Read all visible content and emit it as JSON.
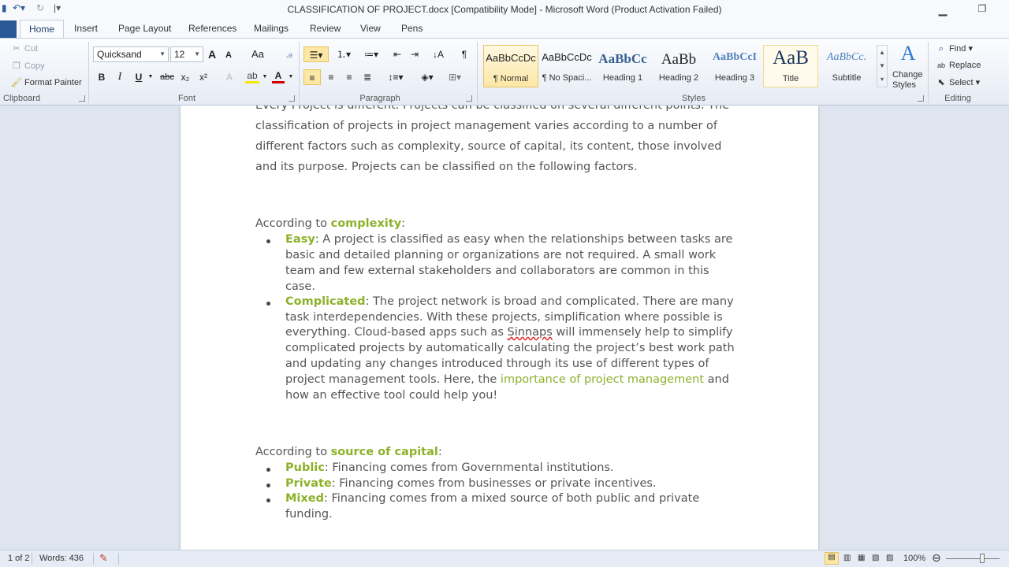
{
  "window": {
    "title": "CLASSIFICATION OF PROJECT.docx [Compatibility Mode]  -  Microsoft Word (Product Activation Failed)"
  },
  "quick_access": {
    "save_icon": "save-icon",
    "undo_icon": "undo-icon",
    "redo_icon": "redo-icon"
  },
  "tabs": [
    {
      "label": "Home",
      "active": true
    },
    {
      "label": "Insert"
    },
    {
      "label": "Page Layout"
    },
    {
      "label": "References"
    },
    {
      "label": "Mailings"
    },
    {
      "label": "Review"
    },
    {
      "label": "View"
    },
    {
      "label": "Pens"
    }
  ],
  "clipboard": {
    "label": "Clipboard",
    "cut": "Cut",
    "copy": "Copy",
    "format_painter": "Format Painter"
  },
  "font": {
    "label": "Font",
    "name": "Quicksand",
    "size": "12",
    "grow": "A",
    "shrink": "A",
    "change_case": "Aa",
    "bold": "B",
    "italic": "I",
    "underline": "U",
    "strikethrough": "abc",
    "subscript": "x₂",
    "superscript": "x²",
    "font_color": "A"
  },
  "paragraph": {
    "label": "Paragraph",
    "show_marks": "¶"
  },
  "styles": {
    "label": "Styles",
    "items": [
      {
        "sample": "AaBbCcDc",
        "name": "¶ Normal"
      },
      {
        "sample": "AaBbCcDc",
        "name": "¶ No Spaci..."
      },
      {
        "sample": "AaBbCc",
        "name": "Heading 1"
      },
      {
        "sample": "AaBb",
        "name": "Heading 2"
      },
      {
        "sample": "AaBbCcI",
        "name": "Heading 3"
      },
      {
        "sample": "AaB",
        "name": "Title"
      },
      {
        "sample": "AaBbCc.",
        "name": "Subtitle"
      }
    ],
    "change_styles_line1": "Change",
    "change_styles_line2": "Styles"
  },
  "editing": {
    "label": "Editing",
    "find": "Find",
    "replace": "Replace",
    "select": "Select"
  },
  "document": {
    "intro_top": "Every Project is different. Projects can be classified on several different points. The",
    "intro": [
      "classification of projects in project management varies according to a number of",
      "different factors such as complexity, source of capital, its content, those involved",
      "and its purpose. Projects can be classified on the following factors."
    ],
    "complexity_heading_prefix": "According to ",
    "complexity_heading_term": "complexity",
    "complexity_heading_suffix": ":",
    "easy_term": "Easy",
    "easy_lines": [
      ": A project is classified as easy when the relationships between tasks are",
      "basic and detailed planning or organizations are not required. A small work",
      "team and few external stakeholders and collaborators are common in this",
      "case."
    ],
    "complicated_term": "Complicated",
    "complicated_line1": ": The project network is broad and complicated. There are many",
    "complicated_line2": "task interdependencies. With these projects, simplification where possible is",
    "complicated_line3_a": "everything. Cloud-based apps such as ",
    "complicated_line3_b": "Sinnaps",
    "complicated_line3_c": " will immensely help to simplify",
    "complicated_line4": "complicated projects by automatically calculating the project’s best work path",
    "complicated_line5": "and updating any changes introduced through its use of different types of",
    "complicated_line6_a": "project management tools. Here, the ",
    "complicated_line6_link": "importance of project management",
    "complicated_line6_b": " and",
    "complicated_line7": "how an effective tool could help you!",
    "capital_heading_prefix": "According to ",
    "capital_heading_term": "source of capital",
    "capital_heading_suffix": ":",
    "public_term": "Public",
    "public_text": ": Financing comes from Governmental institutions.",
    "private_term": "Private",
    "private_text": ": Financing comes from businesses or private incentives.",
    "mixed_term": "Mixed",
    "mixed_text": ": Financing comes from a mixed source of both public and private",
    "mixed_text2": "funding."
  },
  "status": {
    "page": "1 of 2",
    "words": "Words: 436",
    "zoom": "100%"
  },
  "colors": {
    "accent_green": "#8db12a",
    "file_tab": "#2b5797",
    "ribbon_bg": "#e6ecf5"
  }
}
